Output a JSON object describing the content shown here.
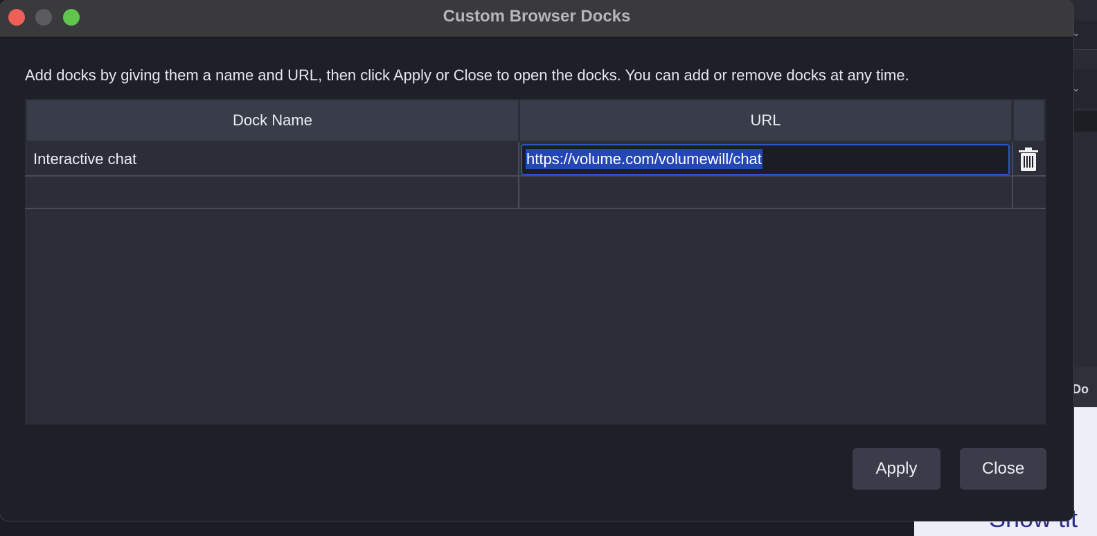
{
  "window": {
    "title": "Custom Browser Docks"
  },
  "description": "Add docks by giving them a name and URL, then click Apply or Close to open the docks. You can add or remove docks at any time.",
  "table": {
    "headers": {
      "dock_name": "Dock Name",
      "url": "URL",
      "actions": ""
    },
    "rows": [
      {
        "dock_name": "Interactive chat",
        "url": "https://volume.com/volumewill/chat",
        "action_icon": "trash-icon"
      },
      {
        "dock_name": "",
        "url": ""
      }
    ]
  },
  "buttons": {
    "apply": "Apply",
    "close": "Close"
  },
  "background": {
    "partial_text": "Show tit",
    "partial_label": "Do"
  },
  "colors": {
    "selection": "#2546b5",
    "focus_border": "#2c55c9",
    "close_light": "#ee5f58",
    "max_light": "#5fc54f"
  }
}
